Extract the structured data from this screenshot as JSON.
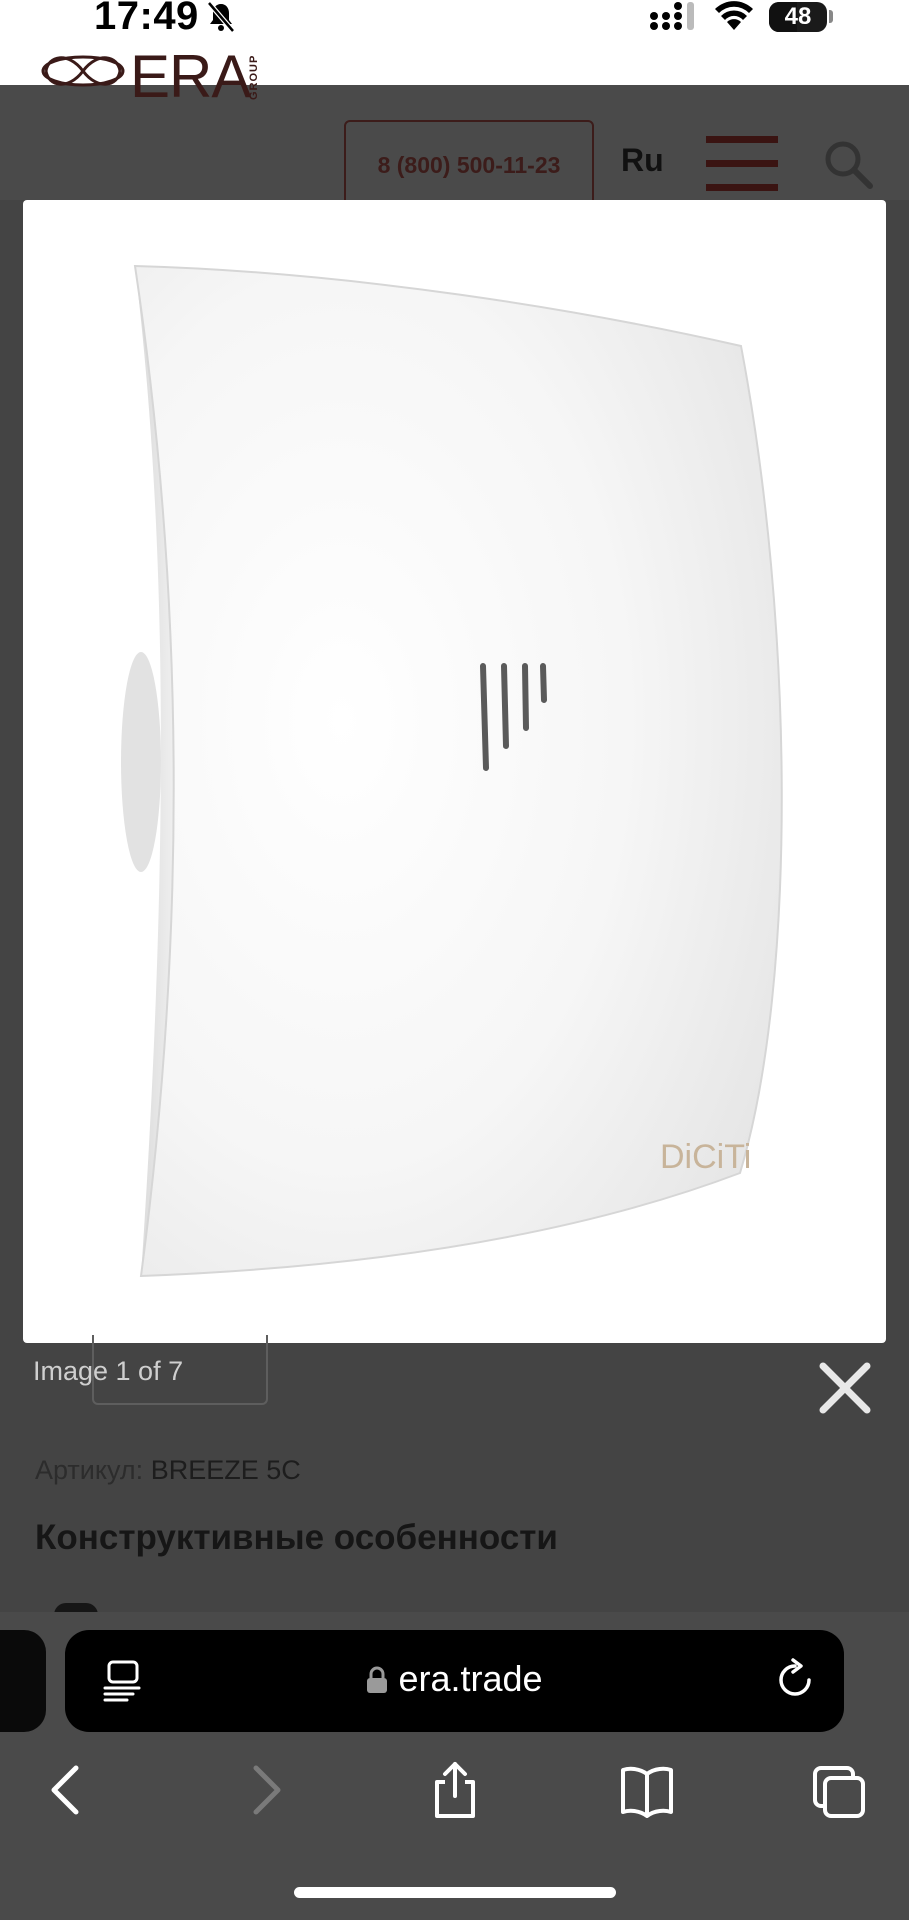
{
  "status_bar": {
    "time": "17:49",
    "battery": "48",
    "battery_level_percent": 48
  },
  "site": {
    "logo_text": "ERA",
    "logo_sub": "GROUP",
    "phone": "8 (800) 500-11-23",
    "language": "Ru"
  },
  "lightbox": {
    "product_brand_mark": "DiCiTi",
    "counter": "Image 1 of 7"
  },
  "page": {
    "sku_label": "Артикул:",
    "sku_value": "BREEZE 5C",
    "section_title": "Конструктивные особенности"
  },
  "safari": {
    "url": "era.trade"
  },
  "colors": {
    "overlay": "#444444",
    "brand_dark_red": "#3c1c1a",
    "address_bar": "#000000"
  },
  "icons": [
    "bell-slash-icon",
    "signal-icon",
    "wifi-icon",
    "menu-icon",
    "search-icon",
    "close-icon",
    "reader-icon",
    "lock-icon",
    "reload-icon",
    "back-icon",
    "forward-icon",
    "share-icon",
    "bookmarks-icon",
    "tabs-icon"
  ]
}
